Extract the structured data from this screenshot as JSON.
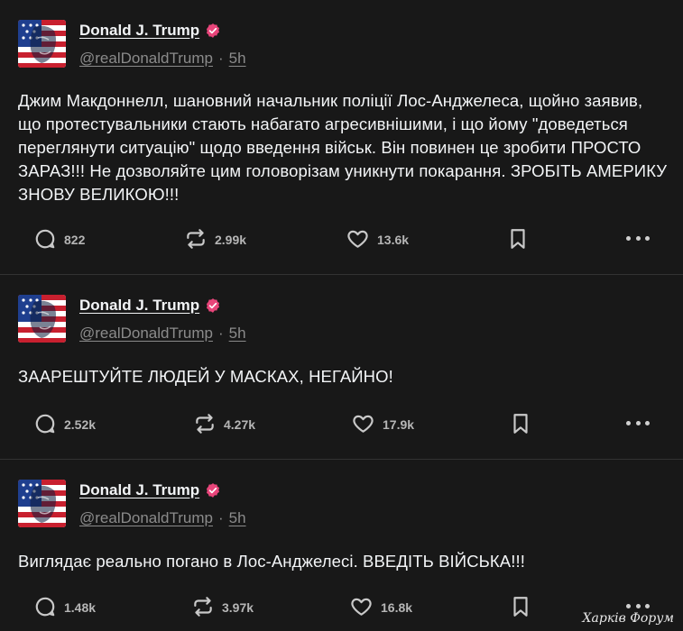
{
  "posts": [
    {
      "author": "Donald J. Trump",
      "handle": "@realDonaldTrump",
      "separator": "·",
      "time": "5h",
      "text": "Джим Макдоннелл, шановний начальник поліції Лос-Анджелеса, щойно заявив, що протестувальники стають набагато агресивнішими, і що йому \"доведеться переглянути ситуацію\" щодо введення військ. Він повинен це зробити ПРОСТО ЗАРАЗ!!! Не дозволяйте цим головорізам уникнути покарання. ЗРОБІТЬ АМЕРИКУ ЗНОВУ ВЕЛИКОЮ!!!",
      "replies": "822",
      "reposts": "2.99k",
      "likes": "13.6k"
    },
    {
      "author": "Donald J. Trump",
      "handle": "@realDonaldTrump",
      "separator": "·",
      "time": "5h",
      "text": "ЗААРЕШТУЙТЕ ЛЮДЕЙ У МАСКАХ, НЕГАЙНО!",
      "replies": "2.52k",
      "reposts": "4.27k",
      "likes": "17.9k"
    },
    {
      "author": "Donald J. Trump",
      "handle": "@realDonaldTrump",
      "separator": "·",
      "time": "5h",
      "text": "Виглядає реально погано в Лос-Анджелесі. ВВЕДІТЬ ВІЙСЬКА!!!",
      "replies": "1.48k",
      "reposts": "3.97k",
      "likes": "16.8k"
    }
  ],
  "watermark": "Харків Форум",
  "colors": {
    "background": "#181818",
    "divider": "#323232",
    "text": "#f3f5f7",
    "muted": "#8b8b8b",
    "verified": "#e8457a"
  }
}
